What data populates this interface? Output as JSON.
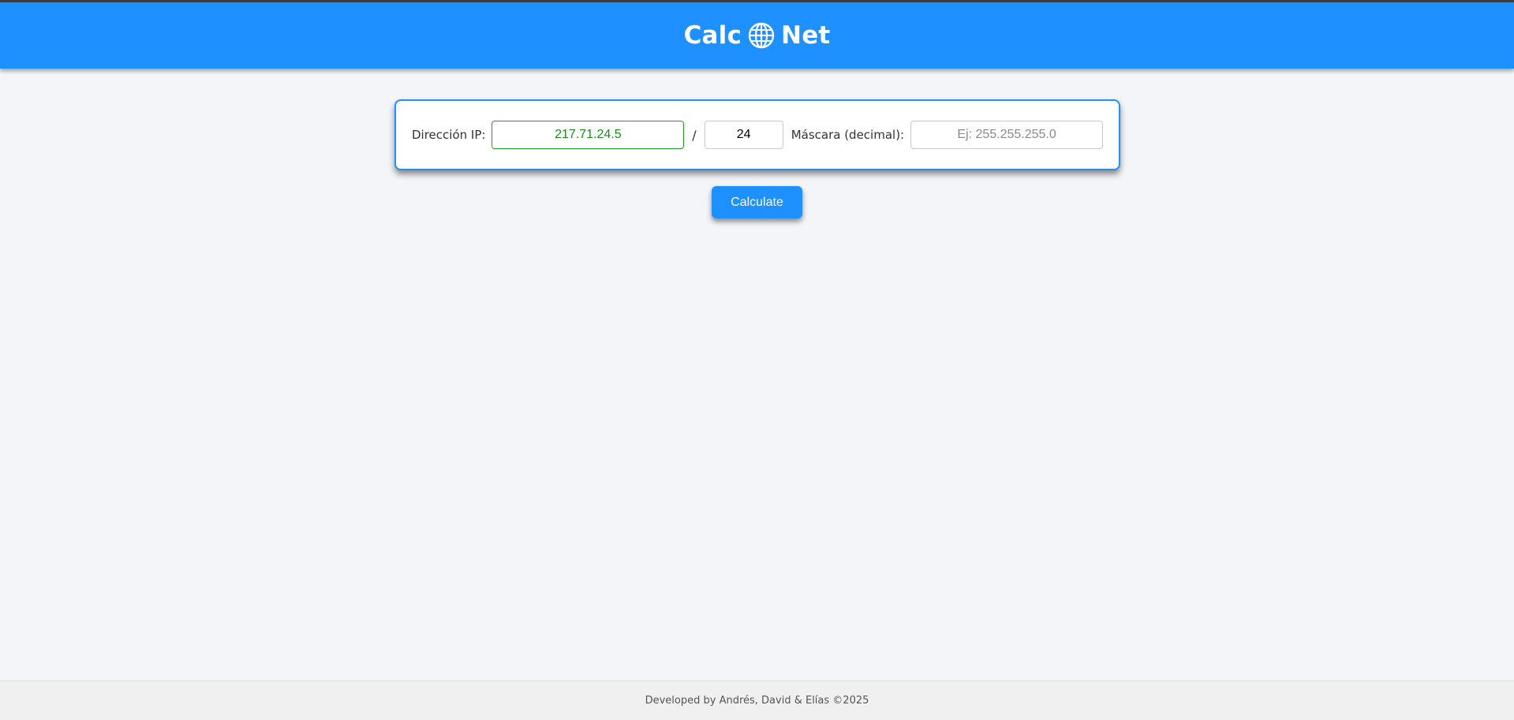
{
  "header": {
    "brand_left": "Calc",
    "brand_icon": "globe-icon",
    "brand_right": "Net",
    "background_color": "#1e90ff"
  },
  "form": {
    "ip_label": "Dirección IP:",
    "ip_value": "217.71.24.5",
    "separator": "/",
    "cidr_value": "24",
    "mask_label": "Máscara (decimal):",
    "mask_value": "",
    "mask_placeholder": "Ej: 255.255.255.0",
    "valid_color": "#1a8f1a"
  },
  "actions": {
    "calculate_label": "Calculate"
  },
  "footer": {
    "credits": "Developed by Andrés, David & Elías ©2025"
  }
}
